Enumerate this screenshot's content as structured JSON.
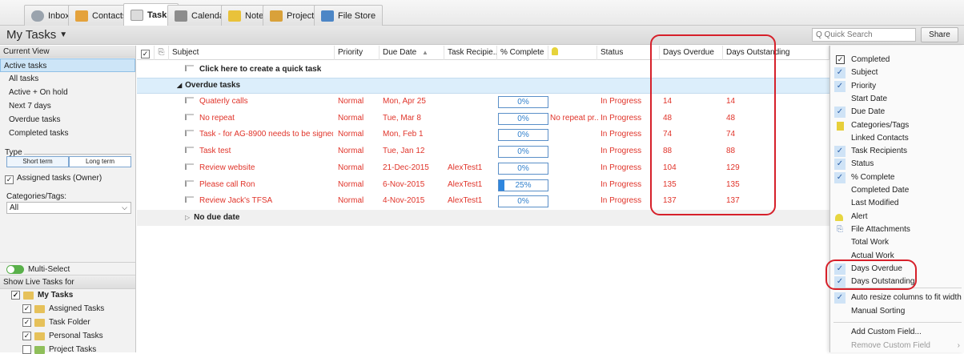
{
  "tabs": [
    {
      "label": "Inbox",
      "icon": "inbox-icon",
      "color": "#9aa3ad"
    },
    {
      "label": "Contacts",
      "icon": "contacts-icon",
      "color": "#e4a23c"
    },
    {
      "label": "Tasks",
      "icon": "tasks-icon",
      "color": "#d9d9d9",
      "active": true
    },
    {
      "label": "Calendar",
      "icon": "calendar-icon",
      "color": "#8c8c8c"
    },
    {
      "label": "Notes",
      "icon": "notes-icon",
      "color": "#e9c23a"
    },
    {
      "label": "Projects",
      "icon": "projects-icon",
      "color": "#d9a13a"
    },
    {
      "label": "File Store",
      "icon": "file-store-icon",
      "color": "#4c86c6"
    }
  ],
  "titlebar": {
    "title": "My Tasks",
    "search_placeholder": "Q Quick Search",
    "share": "Share"
  },
  "sidebar": {
    "current_view": "Current View",
    "views": [
      "Active tasks",
      "All tasks",
      "Active + On hold",
      "Next 7 days",
      "Overdue tasks",
      "Completed tasks"
    ],
    "selected_view": "Active tasks",
    "type_label": "Type",
    "type_short": "Short term",
    "type_long": "Long term",
    "assigned_owner": "Assigned tasks (Owner)",
    "categories_label": "Categories/Tags:",
    "categories_value": "All",
    "multi_select": "Multi-Select",
    "show_live": "Show Live Tasks for",
    "tree": {
      "root": "My Tasks",
      "items": [
        "Assigned Tasks",
        "Task Folder",
        "Personal Tasks",
        "Project Tasks"
      ]
    }
  },
  "grid": {
    "headers": {
      "subject": "Subject",
      "priority": "Priority",
      "due_date": "Due Date",
      "sort_arrow": "▲",
      "recipients": "Task Recipie...",
      "complete": "% Complete",
      "status": "Status",
      "days_overdue": "Days Overdue",
      "days_outstanding": "Days Outstanding"
    },
    "quick_task": "Click here to create a quick task",
    "group_overdue": "Overdue tasks",
    "group_nodue": "No due date",
    "rows": [
      {
        "subject": "Quaterly calls",
        "priority": "Normal",
        "due": "Mon, Apr 25",
        "recipient": "",
        "pct": 0,
        "pct_label": "0%",
        "alert": "",
        "status": "In Progress",
        "overdue": "14",
        "outstanding": "14"
      },
      {
        "subject": "No repeat",
        "priority": "Normal",
        "due": "Tue, Mar 8",
        "recipient": "",
        "pct": 0,
        "pct_label": "0%",
        "alert": "No repeat pr...",
        "status": "In Progress",
        "overdue": "48",
        "outstanding": "48"
      },
      {
        "subject": "Task - for AG-8900 needs to be signed by ...",
        "priority": "Normal",
        "due": "Mon, Feb 1",
        "recipient": "",
        "pct": 0,
        "pct_label": "0%",
        "alert": "",
        "status": "In Progress",
        "overdue": "74",
        "outstanding": "74"
      },
      {
        "subject": "Task test",
        "priority": "Normal",
        "due": "Tue, Jan 12",
        "recipient": "",
        "pct": 0,
        "pct_label": "0%",
        "alert": "",
        "status": "In Progress",
        "overdue": "88",
        "outstanding": "88"
      },
      {
        "subject": "Review website",
        "priority": "Normal",
        "due": "21-Dec-2015",
        "recipient": "AlexTest1",
        "pct": 0,
        "pct_label": "0%",
        "alert": "",
        "status": "In Progress",
        "overdue": "104",
        "outstanding": "129"
      },
      {
        "subject": "Please call Ron",
        "priority": "Normal",
        "due": "6-Nov-2015",
        "recipient": "AlexTest1",
        "pct": 25,
        "pct_label": "25%",
        "alert": "",
        "status": "In Progress",
        "overdue": "135",
        "outstanding": "135"
      },
      {
        "subject": "Review Jack's TFSA",
        "priority": "Normal",
        "due": "4-Nov-2015",
        "recipient": "AlexTest1",
        "pct": 0,
        "pct_label": "0%",
        "alert": "",
        "status": "In Progress",
        "overdue": "137",
        "outstanding": "137"
      }
    ]
  },
  "menu": {
    "items": [
      {
        "label": "Completed",
        "mark": "checkbox"
      },
      {
        "label": "Subject",
        "mark": "check"
      },
      {
        "label": "Priority",
        "mark": "check"
      },
      {
        "label": "Start Date",
        "mark": ""
      },
      {
        "label": "Due Date",
        "mark": "check"
      },
      {
        "label": "Categories/Tags",
        "mark": "tag"
      },
      {
        "label": "Linked Contacts",
        "mark": ""
      },
      {
        "label": "Task Recipients",
        "mark": "check"
      },
      {
        "label": "Status",
        "mark": "check"
      },
      {
        "label": "% Complete",
        "mark": "check"
      },
      {
        "label": "Completed Date",
        "mark": ""
      },
      {
        "label": "Last Modified",
        "mark": ""
      },
      {
        "label": "Alert",
        "mark": "alert"
      },
      {
        "label": "File Attachments",
        "mark": "clip"
      },
      {
        "label": "Total Work",
        "mark": ""
      },
      {
        "label": "Actual Work",
        "mark": ""
      },
      {
        "label": "Days Overdue",
        "mark": "check"
      },
      {
        "label": "Days Outstanding",
        "mark": "check"
      }
    ],
    "auto_resize": "Auto resize columns to fit width",
    "manual_sorting": "Manual Sorting",
    "add_custom": "Add Custom Field...",
    "remove_custom": "Remove Custom Field",
    "submenu_arrow": "›"
  },
  "colors": {
    "overdue_red": "#e0342a",
    "group_bg": "#dceefb",
    "highlight": "#d6202a",
    "accent_blue": "#2e86de"
  }
}
